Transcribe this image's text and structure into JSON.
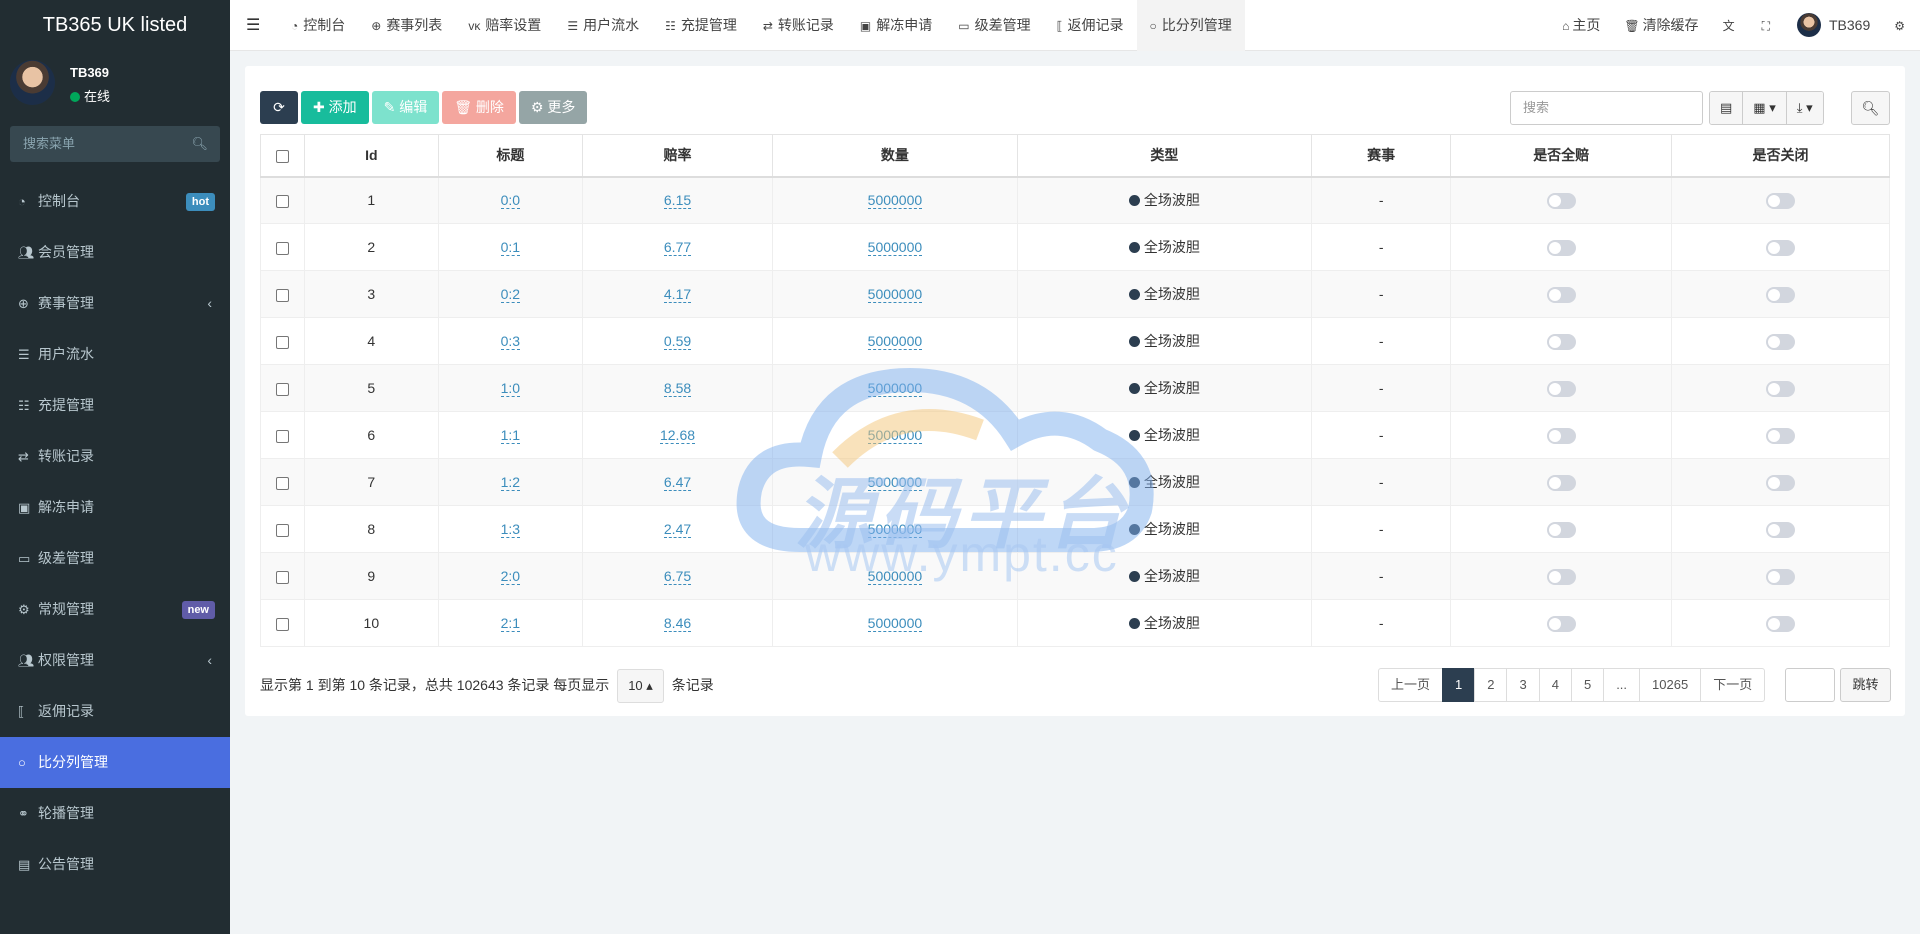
{
  "app": {
    "title": "TB365 UK listed"
  },
  "user": {
    "name": "TB369",
    "status": "在线"
  },
  "sidebar": {
    "search_placeholder": "搜索菜单",
    "items": [
      {
        "label": "控制台",
        "badge": "hot"
      },
      {
        "label": "会员管理"
      },
      {
        "label": "赛事管理"
      },
      {
        "label": "用户流水"
      },
      {
        "label": "充提管理"
      },
      {
        "label": "转账记录"
      },
      {
        "label": "解冻申请"
      },
      {
        "label": "级差管理"
      },
      {
        "label": "常规管理",
        "badge": "new"
      },
      {
        "label": "权限管理"
      },
      {
        "label": "返佣记录"
      },
      {
        "label": "比分列管理"
      },
      {
        "label": "轮播管理"
      },
      {
        "label": "公告管理"
      }
    ]
  },
  "topbar": {
    "tabs": [
      "控制台",
      "赛事列表",
      "赔率设置",
      "用户流水",
      "充提管理",
      "转账记录",
      "解冻申请",
      "级差管理",
      "返佣记录",
      "比分列管理"
    ],
    "home": "主页",
    "clear_cache": "清除缓存",
    "user": "TB369"
  },
  "toolbar": {
    "add": "添加",
    "edit": "编辑",
    "delete": "删除",
    "more": "更多",
    "search_placeholder": "搜索"
  },
  "table": {
    "headers": [
      "Id",
      "标题",
      "赔率",
      "数量",
      "类型",
      "赛事",
      "是否全赔",
      "是否关闭"
    ],
    "rows": [
      {
        "id": "1",
        "title": "0:0",
        "odds": "6.15",
        "qty": "5000000",
        "type": "全场波胆",
        "match": "-"
      },
      {
        "id": "2",
        "title": "0:1",
        "odds": "6.77",
        "qty": "5000000",
        "type": "全场波胆",
        "match": "-"
      },
      {
        "id": "3",
        "title": "0:2",
        "odds": "4.17",
        "qty": "5000000",
        "type": "全场波胆",
        "match": "-"
      },
      {
        "id": "4",
        "title": "0:3",
        "odds": "0.59",
        "qty": "5000000",
        "type": "全场波胆",
        "match": "-"
      },
      {
        "id": "5",
        "title": "1:0",
        "odds": "8.58",
        "qty": "5000000",
        "type": "全场波胆",
        "match": "-"
      },
      {
        "id": "6",
        "title": "1:1",
        "odds": "12.68",
        "qty": "5000000",
        "type": "全场波胆",
        "match": "-"
      },
      {
        "id": "7",
        "title": "1:2",
        "odds": "6.47",
        "qty": "5000000",
        "type": "全场波胆",
        "match": "-"
      },
      {
        "id": "8",
        "title": "1:3",
        "odds": "2.47",
        "qty": "5000000",
        "type": "全场波胆",
        "match": "-"
      },
      {
        "id": "9",
        "title": "2:0",
        "odds": "6.75",
        "qty": "5000000",
        "type": "全场波胆",
        "match": "-"
      },
      {
        "id": "10",
        "title": "2:1",
        "odds": "8.46",
        "qty": "5000000",
        "type": "全场波胆",
        "match": "-"
      }
    ]
  },
  "pagination": {
    "info_prefix": "显示第 1 到第 10 条记录，总共 102643 条记录 每页显示",
    "page_size": "10",
    "info_suffix": "条记录",
    "prev": "上一页",
    "pages": [
      "1",
      "2",
      "3",
      "4",
      "5",
      "...",
      "10265"
    ],
    "next": "下一页",
    "jump": "跳转"
  },
  "watermark": {
    "line1": "源码平台",
    "line2": "www.ympt.cc"
  }
}
